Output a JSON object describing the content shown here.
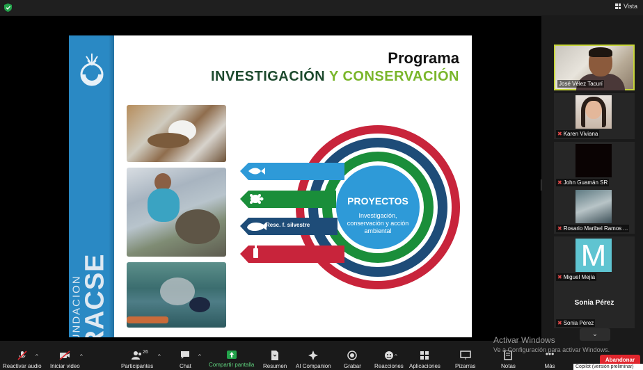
{
  "topbar": {
    "view_label": "Vista"
  },
  "slide": {
    "brand_small": "FUNDACION",
    "brand_big": "RACSE",
    "title_line1": "Programa",
    "title_part1": "INVESTIGACIÓN ",
    "title_part2": "Y CONSERVACIÓN",
    "projects_title": "PROYECTOS",
    "projects_sub": "Investigación, conservación y acción ambiental",
    "band_label": "Resc. f. silvestre"
  },
  "colors": {
    "strip_blue": "#2a89c4",
    "ring_red": "#c8243b",
    "ring_navy": "#1e4c78",
    "ring_green": "#1a8e3a",
    "ring_blue": "#2e9ad8",
    "active_border": "#c7d63b",
    "leave_red": "#e0262d"
  },
  "participants": [
    {
      "name": "José Vélez Tacurí",
      "muted": false,
      "active": true
    },
    {
      "name": "Karen Viviana",
      "muted": true
    },
    {
      "name": "John Guamán SR",
      "muted": true
    },
    {
      "name": "Rosario Maribel Ramos ...",
      "muted": true
    },
    {
      "name": "Miguel Mejía",
      "muted": true
    },
    {
      "name": "Sonia Pérez",
      "display_name": "Sonia Pérez",
      "muted": true
    }
  ],
  "toolbar": {
    "mute": "Reactivar audio",
    "video": "Iniciar video",
    "participants": "Participantes",
    "participants_count": "26",
    "chat": "Chat",
    "share": "Compartir pantalla",
    "summary": "Resumen",
    "companion": "AI Companion",
    "record": "Grabar",
    "reactions": "Reacciones",
    "apps": "Aplicaciones",
    "whiteboards": "Pizarras",
    "notes": "Notas",
    "more": "Más",
    "leave": "Abandonar"
  },
  "watermark": {
    "line1": "Activar Windows",
    "line2": "Ve a Configuración para activar Windows."
  },
  "tooltip": "Copilot (versión preliminar)"
}
